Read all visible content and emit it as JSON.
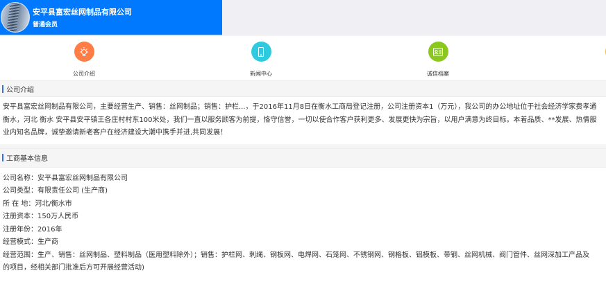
{
  "header": {
    "company_name": "安平县富宏丝网制品有限公司",
    "member_level": "普通会员",
    "brand_color": "#0079fe"
  },
  "nav": [
    {
      "label": "公司介绍",
      "icon": "lightbulb-icon",
      "color": "#ff7d45"
    },
    {
      "label": "新闻中心",
      "icon": "mobile-icon",
      "color": "#2ecbe0"
    },
    {
      "label": "诚信档案",
      "icon": "id-card-icon",
      "color": "#8bc81e"
    },
    {
      "label": "",
      "icon": "unknown-icon",
      "color": "#f5b642"
    }
  ],
  "intro": {
    "title": "公司介绍",
    "lines": [
      "安平县富宏丝网制品有限公司，主要经营生产、销售：丝网制品；销售：护栏...，于2016年11月8日在衡水工商局登记注册，公司注册资本1（万元），我公司的办公地址位于社会经济学家费孝通",
      "衡水，河北 衡水 安平县安平镇王各庄村村东100米处，我们一直以服务顾客为前提，恪守信誉，一切以使合作客户获利更多、发展更快为宗旨，以用户满意为终目标。本着品质、**发展、热情服",
      "业内知名品牌，诚挚邀请新老客户在经济建设大潮中携手并进,共同发展！"
    ]
  },
  "business": {
    "title": "工商基本信息",
    "lines": [
      "公司名称：安平县富宏丝网制品有限公司",
      "公司类型：有限责任公司 (生产商)",
      "所 在 地：河北/衡水市",
      "注册资本：150万人民币",
      "注册年份：2016年",
      "经营模式：生产商",
      "经营范围：生产、销售：丝网制品、塑料制品（医用塑料除外）；销售：护栏网、刺绳、钢板网、电焊网、石笼网、不锈钢网、钢格板、铝模板、带钢、丝网机械、阀门管件、丝网深加工产品及",
      "的项目，经相关部门批准后方可开展经营活动)"
    ]
  }
}
